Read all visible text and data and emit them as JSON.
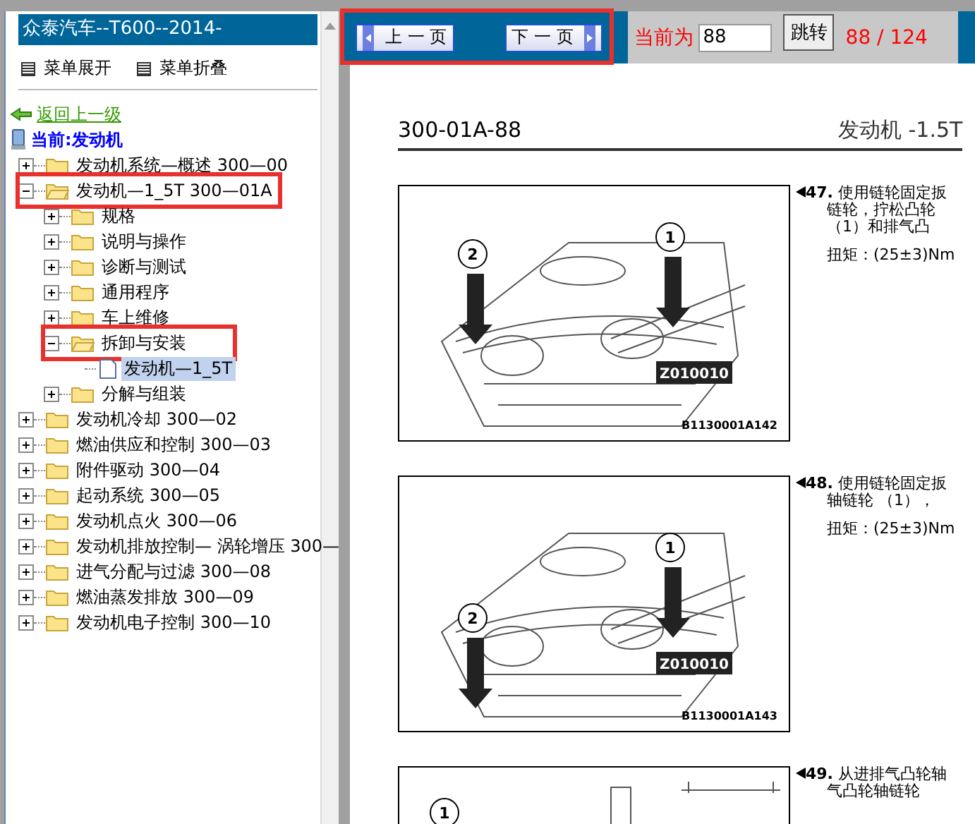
{
  "sidebar": {
    "title": "众泰汽车--T600--2014-",
    "menu": [
      {
        "label": "菜单展开"
      },
      {
        "label": "菜单折叠"
      }
    ],
    "back_link": "返回上一级",
    "current": "当前:发动机",
    "tree": [
      {
        "label": "发动机系统—概述 300—00",
        "kind": "folder",
        "expanded": false,
        "selected": false,
        "outlined": false
      },
      {
        "label": "发动机—1_5T 300—01A",
        "kind": "folder",
        "expanded": true,
        "selected": false,
        "outlined": true,
        "children": [
          {
            "label": "规格",
            "kind": "folder",
            "expanded": false,
            "selected": false,
            "outlined": false
          },
          {
            "label": "说明与操作",
            "kind": "folder",
            "expanded": false,
            "selected": false,
            "outlined": false
          },
          {
            "label": "诊断与测试",
            "kind": "folder",
            "expanded": false,
            "selected": false,
            "outlined": false
          },
          {
            "label": "通用程序",
            "kind": "folder",
            "expanded": false,
            "selected": false,
            "outlined": false
          },
          {
            "label": "车上维修",
            "kind": "folder",
            "expanded": false,
            "selected": false,
            "outlined": false
          },
          {
            "label": "拆卸与安装",
            "kind": "folder",
            "expanded": true,
            "selected": false,
            "outlined": true,
            "children": [
              {
                "label": "发动机—1_5T",
                "kind": "page",
                "selected": true
              }
            ]
          },
          {
            "label": "分解与组装",
            "kind": "folder",
            "expanded": false,
            "selected": false,
            "outlined": false
          }
        ]
      },
      {
        "label": "发动机冷却 300—02",
        "kind": "folder",
        "expanded": false,
        "selected": false,
        "outlined": false
      },
      {
        "label": "燃油供应和控制 300—03",
        "kind": "folder",
        "expanded": false,
        "selected": false,
        "outlined": false
      },
      {
        "label": "附件驱动 300—04",
        "kind": "folder",
        "expanded": false,
        "selected": false,
        "outlined": false
      },
      {
        "label": "起动系统 300—05",
        "kind": "folder",
        "expanded": false,
        "selected": false,
        "outlined": false
      },
      {
        "label": "发动机点火 300—06",
        "kind": "folder",
        "expanded": false,
        "selected": false,
        "outlined": false
      },
      {
        "label": "发动机排放控制— 涡轮增压 300—",
        "kind": "folder",
        "expanded": false,
        "selected": false,
        "outlined": false
      },
      {
        "label": "进气分配与过滤 300—08",
        "kind": "folder",
        "expanded": false,
        "selected": false,
        "outlined": false
      },
      {
        "label": "燃油蒸发排放 300—09",
        "kind": "folder",
        "expanded": false,
        "selected": false,
        "outlined": false
      },
      {
        "label": "发动机电子控制 300—10",
        "kind": "folder",
        "expanded": false,
        "selected": false,
        "outlined": false
      }
    ]
  },
  "toolbar": {
    "prev": "上 一 页",
    "next": "下 一 页",
    "nav_outlined": true,
    "current_label": "当前为",
    "page_input": "88",
    "go_button": "跳转",
    "page_count": "88 / 124"
  },
  "document": {
    "code": "300-01A-88",
    "title": "发动机 -1.5T",
    "steps": [
      {
        "number": "47.",
        "lines": [
          "使用链轮固定扳",
          "链轮，拧松凸轮",
          "（1）和排气凸"
        ],
        "torque": "扭矩：(25±3)Nm",
        "figure": {
          "callouts": [
            "2",
            "1"
          ],
          "tool": "Z010010",
          "code": "B1130001A142"
        }
      },
      {
        "number": "48.",
        "lines": [
          "使用链轮固定扳",
          "轴链轮 （1），"
        ],
        "torque": "扭矩：(25±3)Nm",
        "figure": {
          "callouts": [
            "1",
            "2"
          ],
          "tool": "Z010010",
          "code": "B1130001A143"
        }
      },
      {
        "number": "49.",
        "lines": [
          "从进排气凸轮轴",
          "气凸轮轴链轮"
        ],
        "figure": {
          "callouts": [
            "1"
          ]
        }
      }
    ]
  }
}
